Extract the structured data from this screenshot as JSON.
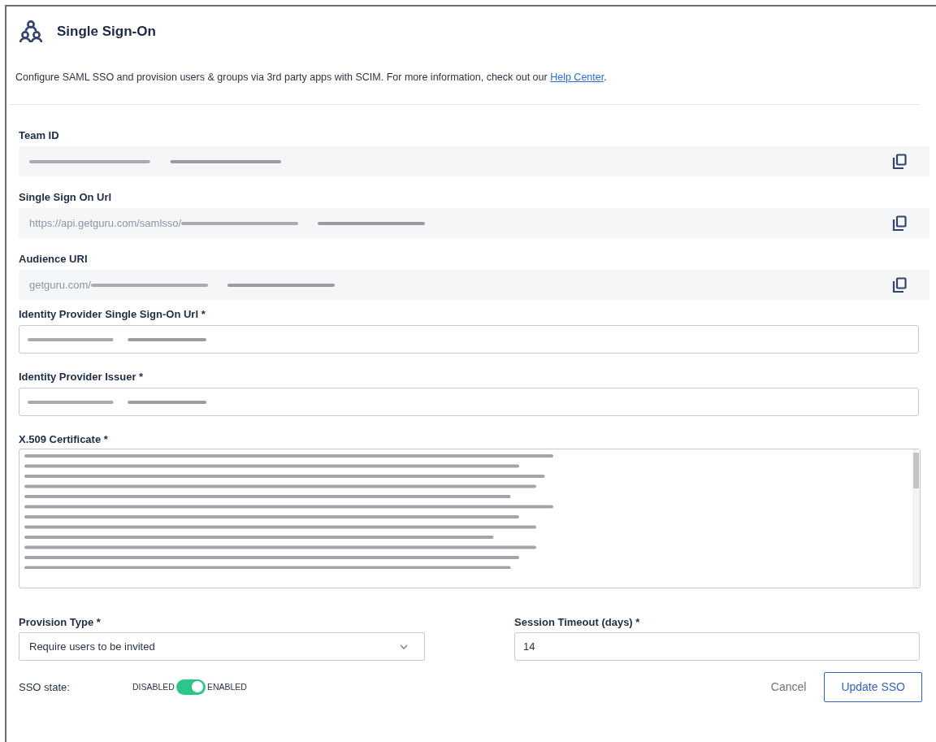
{
  "header": {
    "title": "Single Sign-On"
  },
  "description": {
    "text": "Configure SAML SSO and provision users & groups via 3rd party apps with SCIM. For more information, check out our ",
    "link": "Help Center",
    "after": "."
  },
  "fields": [
    {
      "kind": "readonly",
      "label": "Team ID",
      "redacted": true
    },
    {
      "kind": "readonly",
      "label": "Single Sign On Url",
      "value": "https://api.getguru.com/samlsso/",
      "redacted": true
    },
    {
      "kind": "readonly",
      "label": "Audience URI",
      "value": "getguru.com/",
      "redacted": true
    },
    {
      "kind": "input",
      "label": "Identity Provider Single Sign-On Url *",
      "redacted": true
    },
    {
      "kind": "input",
      "label": "Identity Provider Issuer *",
      "redacted": true
    },
    {
      "kind": "textarea",
      "label": "X.509 Certificate *",
      "redacted": true
    }
  ],
  "provision_type": {
    "label": "Provision Type *",
    "value": "Require users to be invited"
  },
  "session_timeout": {
    "label": "Session Timeout (days) *",
    "value": "14"
  },
  "sso_state": {
    "label": "SSO state:",
    "off_label": "DISABLED",
    "on_label": "ENABLED",
    "on": true
  },
  "buttons": {
    "cancel": "Cancel",
    "submit": "Update SSO"
  }
}
